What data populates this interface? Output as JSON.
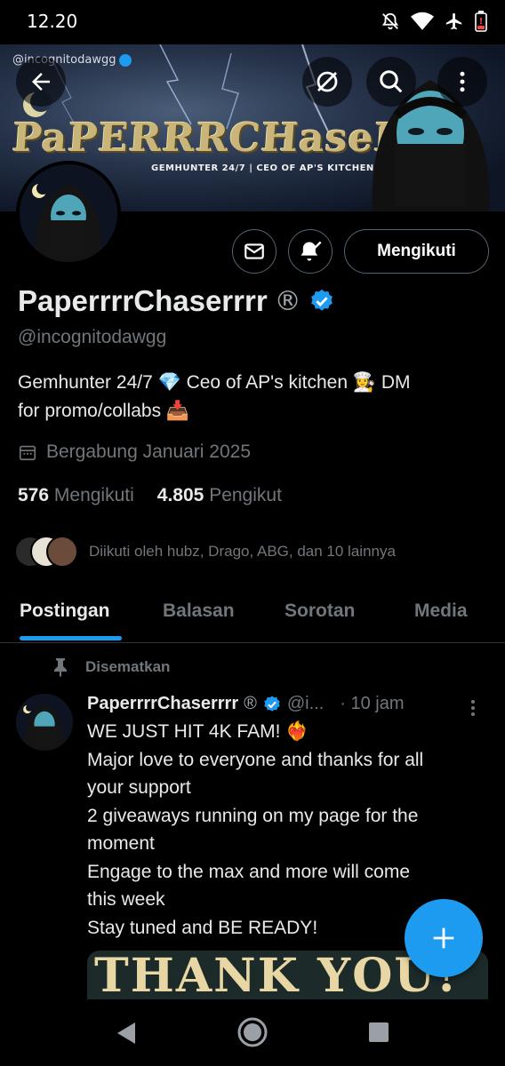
{
  "status_bar": {
    "time": "12.20",
    "icons": [
      "notifications-off-icon",
      "wifi-icon",
      "airplane-mode-icon",
      "battery-low-icon"
    ]
  },
  "banner": {
    "handle_watermark": "@incognitodawgg",
    "title_art": "PaPERRRCHaseRRR",
    "subtitle_art": "GEMHUNTER 24/7 | CEO OF AP'S KITCHEN"
  },
  "header_actions": {
    "back_icon": "arrow-left-icon",
    "grok_icon": "grok-icon",
    "search_icon": "search-icon",
    "more_icon": "more-vertical-icon"
  },
  "profile": {
    "display_name": "PaperrrrChaserrrr",
    "registered_mark": "®",
    "handle": "@incognitodawgg",
    "bio_line1": "Gemhunter 24/7 💎  Ceo of AP's kitchen 👩‍🍳 DM",
    "bio_line2": "for promo/collabs 📥",
    "joined": "Bergabung Januari 2025",
    "following_count": "576",
    "following_label": "Mengikuti",
    "followers_count": "4.805",
    "followers_label": "Pengikut",
    "followed_by": "Diikuti oleh hubz, Drago, ABG, dan 10 lainnya"
  },
  "buttons": {
    "message_icon": "mail-icon",
    "notify_icon": "bell-check-icon",
    "follow_label": "Mengikuti"
  },
  "tabs": [
    {
      "label": "Postingan",
      "active": true
    },
    {
      "label": "Balasan",
      "active": false
    },
    {
      "label": "Sorotan",
      "active": false
    },
    {
      "label": "Media",
      "active": false
    }
  ],
  "pinned_tweet": {
    "pinned_label": "Disematkan",
    "author_name": "PaperrrrChaserrrr",
    "registered_mark": "®",
    "author_handle": "@i...",
    "time": "· 10 jam",
    "lines": [
      "WE JUST HIT 4K FAM! ❤️‍🔥",
      "Major love to everyone and thanks for all",
      "your support",
      "2 giveaways running on my page for the",
      "moment",
      "Engage to the max and more will come",
      "this week",
      "Stay tuned and BE READY!"
    ],
    "media_text": "THANK YOU!"
  },
  "colors": {
    "accent": "#1d9bf0",
    "background": "#000000",
    "text_primary": "#e7e9ea",
    "text_secondary": "#71767b",
    "border": "#2f3336"
  }
}
